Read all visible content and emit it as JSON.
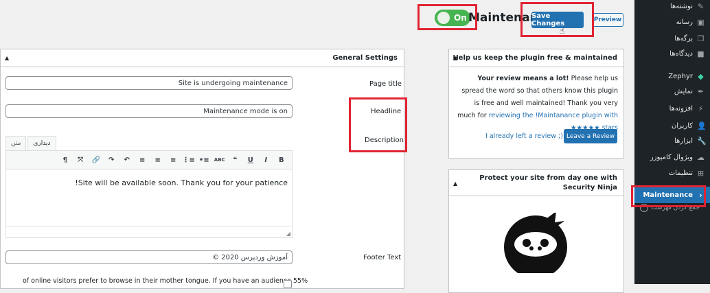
{
  "header": {
    "toggle_label": "On",
    "page_title": "Maintenance",
    "save_label": "Save Changes",
    "preview_label": "Preview"
  },
  "sidebar": {
    "items": [
      {
        "label": "نوشته‌ها",
        "icon": "pin-icon"
      },
      {
        "label": "رسانه",
        "icon": "media-icon"
      },
      {
        "label": "برگه‌ها",
        "icon": "pages-icon"
      },
      {
        "label": "دیدگاه‌ها",
        "icon": "comments-icon"
      },
      {
        "label": "Zephyr",
        "icon": "gem-icon"
      },
      {
        "label": "نمایش",
        "icon": "brush-icon"
      },
      {
        "label": "افزونه‌ها",
        "icon": "plugin-icon"
      },
      {
        "label": "کاربران",
        "icon": "user-icon"
      },
      {
        "label": "ابزارها",
        "icon": "wrench-icon"
      },
      {
        "label": "ویژوال کامپوزر",
        "icon": "cloud-icon"
      },
      {
        "label": "تنظیمات",
        "icon": "settings-icon"
      },
      {
        "label": "Maintenance",
        "icon": "chevron-icon"
      }
    ],
    "collapse_label": "جمع کردن فهرست"
  },
  "general": {
    "title": "General Settings",
    "page_title_label": "Page title",
    "page_title_value": "Site is undergoing maintenance",
    "headline_label": "Headline",
    "headline_value": "Maintenance mode is on",
    "description_label": "Description",
    "tab_visual": "دیداری",
    "tab_text": "متن",
    "editor_content": "!Site will be available soon. Thank you for your patience",
    "footer_label": "Footer Text",
    "footer_value": "© آموزش وردپرس 2020",
    "bottom_text": "of online visitors prefer to browse in their mother tongue. If you have an audience 55%"
  },
  "review": {
    "title": "Help us keep the plugin free & maintained",
    "bold": "Your review means a lot!",
    "text": " Please help us spread the word so that others know this plugin is free and well maintained! Thank you very much for ",
    "link": "reviewing the !Maintanance plugin with ★★★★★ stars",
    "button": "Leave a Review",
    "already": "I already left a review ;)"
  },
  "security": {
    "title": "Protect your site from day one with Security Ninja"
  },
  "colors": {
    "accent": "#2271b1",
    "toggle_on": "#46b450",
    "annotation": "#e02433",
    "sidebar_bg": "#1d2327"
  }
}
